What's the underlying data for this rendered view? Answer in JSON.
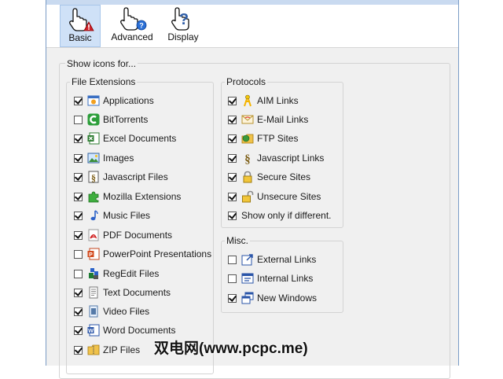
{
  "tabs": [
    {
      "label": "Basic",
      "icon": "hand-warning-icon"
    },
    {
      "label": "Advanced",
      "icon": "hand-info-icon"
    },
    {
      "label": "Display",
      "icon": "hand-question-icon"
    }
  ],
  "main_title": "Show icons for...",
  "file_ext": {
    "title": "File Extensions",
    "items": [
      {
        "label": "Applications",
        "checked": true,
        "icon": "application-icon"
      },
      {
        "label": "BitTorrents",
        "checked": false,
        "icon": "bittorrent-icon"
      },
      {
        "label": "Excel Documents",
        "checked": true,
        "icon": "excel-icon"
      },
      {
        "label": "Images",
        "checked": true,
        "icon": "image-icon"
      },
      {
        "label": "Javascript Files",
        "checked": true,
        "icon": "javascript-icon"
      },
      {
        "label": "Mozilla Extensions",
        "checked": true,
        "icon": "puzzle-icon"
      },
      {
        "label": "Music Files",
        "checked": true,
        "icon": "music-note-icon"
      },
      {
        "label": "PDF Documents",
        "checked": true,
        "icon": "pdf-icon"
      },
      {
        "label": "PowerPoint Presentations",
        "checked": false,
        "icon": "powerpoint-icon"
      },
      {
        "label": "RegEdit Files",
        "checked": false,
        "icon": "regedit-icon"
      },
      {
        "label": "Text Documents",
        "checked": true,
        "icon": "text-document-icon"
      },
      {
        "label": "Video Files",
        "checked": true,
        "icon": "video-file-icon"
      },
      {
        "label": "Word Documents",
        "checked": true,
        "icon": "word-icon"
      },
      {
        "label": "ZIP Files",
        "checked": true,
        "icon": "zip-folder-icon"
      }
    ]
  },
  "protocols": {
    "title": "Protocols",
    "items": [
      {
        "label": "AIM Links",
        "checked": true,
        "icon": "aim-icon"
      },
      {
        "label": "E-Mail Links",
        "checked": true,
        "icon": "email-icon"
      },
      {
        "label": "FTP Sites",
        "checked": true,
        "icon": "ftp-icon"
      },
      {
        "label": "Javascript Links",
        "checked": true,
        "icon": "javascript-icon"
      },
      {
        "label": "Secure Sites",
        "checked": true,
        "icon": "lock-icon"
      },
      {
        "label": "Unsecure Sites",
        "checked": true,
        "icon": "unlock-icon"
      },
      {
        "label": "Show only if different.",
        "checked": true,
        "icon": ""
      }
    ]
  },
  "misc": {
    "title": "Misc.",
    "items": [
      {
        "label": "External Links",
        "checked": false,
        "icon": "external-link-icon"
      },
      {
        "label": "Internal Links",
        "checked": false,
        "icon": "internal-link-icon"
      },
      {
        "label": "New Windows",
        "checked": true,
        "icon": "new-window-icon"
      }
    ]
  },
  "watermark": "双电网(www.pcpc.me)"
}
